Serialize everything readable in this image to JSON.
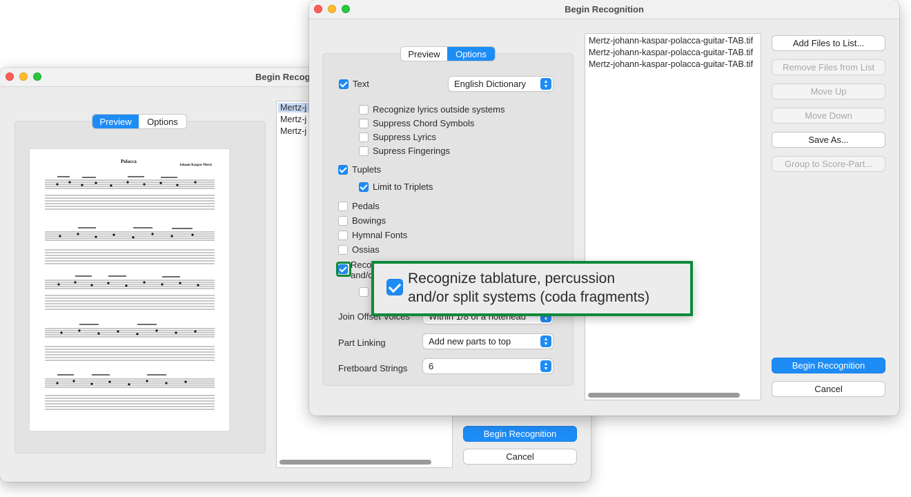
{
  "back_window": {
    "title": "Begin Recognition",
    "tabs": [
      "Preview",
      "Options"
    ],
    "active_tab": "Preview",
    "score": {
      "title": "Polacca",
      "composer": "Johann Kaspar Mertz"
    },
    "files": [
      "Mertz-j",
      "Mertz-j",
      "Mertz-j"
    ],
    "begin_label": "Begin Recognition",
    "cancel_label": "Cancel"
  },
  "front_window": {
    "title": "Begin Recognition",
    "tabs": [
      "Preview",
      "Options"
    ],
    "active_tab": "Options",
    "options": {
      "text_label": "Text",
      "text_checked": true,
      "dictionary_value": "English Dictionary",
      "text_suboptions": [
        {
          "label": "Recognize lyrics outside systems",
          "checked": false
        },
        {
          "label": "Suppress Chord Symbols",
          "checked": false
        },
        {
          "label": "Suppress Lyrics",
          "checked": false
        },
        {
          "label": "Supress Fingerings",
          "checked": false
        }
      ],
      "tuplets_label": "Tuplets",
      "tuplets_checked": true,
      "limit_triplets_label": "Limit to Triplets",
      "limit_triplets_checked": true,
      "checks": [
        {
          "label": "Pedals",
          "checked": false
        },
        {
          "label": "Bowings",
          "checked": false
        },
        {
          "label": "Hymnal Fonts",
          "checked": false
        },
        {
          "label": "Ossias",
          "checked": false
        }
      ],
      "tab_label_line1": "Reco",
      "tab_label_line2": "and/c",
      "tab_checked": true,
      "join_offset_label": "Join Offset Voices",
      "join_offset_value": "Within 1/8 of a notehead",
      "part_linking_label": "Part Linking",
      "part_linking_value": "Add new parts to top",
      "fretboard_label": "Fretboard Strings",
      "fretboard_value": "6"
    },
    "files": [
      "Mertz-johann-kaspar-polacca-guitar-TAB.tif",
      "Mertz-johann-kaspar-polacca-guitar-TAB.tif",
      "Mertz-johann-kaspar-polacca-guitar-TAB.tif"
    ],
    "buttons": {
      "add_files": "Add Files to List...",
      "remove_files": "Remove Files from List",
      "move_up": "Move Up",
      "move_down": "Move Down",
      "save_as": "Save As...",
      "group": "Group to Score-Part...",
      "begin": "Begin Recognition",
      "cancel": "Cancel"
    }
  },
  "callout": {
    "line1": "Recognize tablature, percussion",
    "line2": "and/or split systems (coda fragments)",
    "color": "#0d8a3a"
  },
  "accent_color": "#1e8cf5"
}
